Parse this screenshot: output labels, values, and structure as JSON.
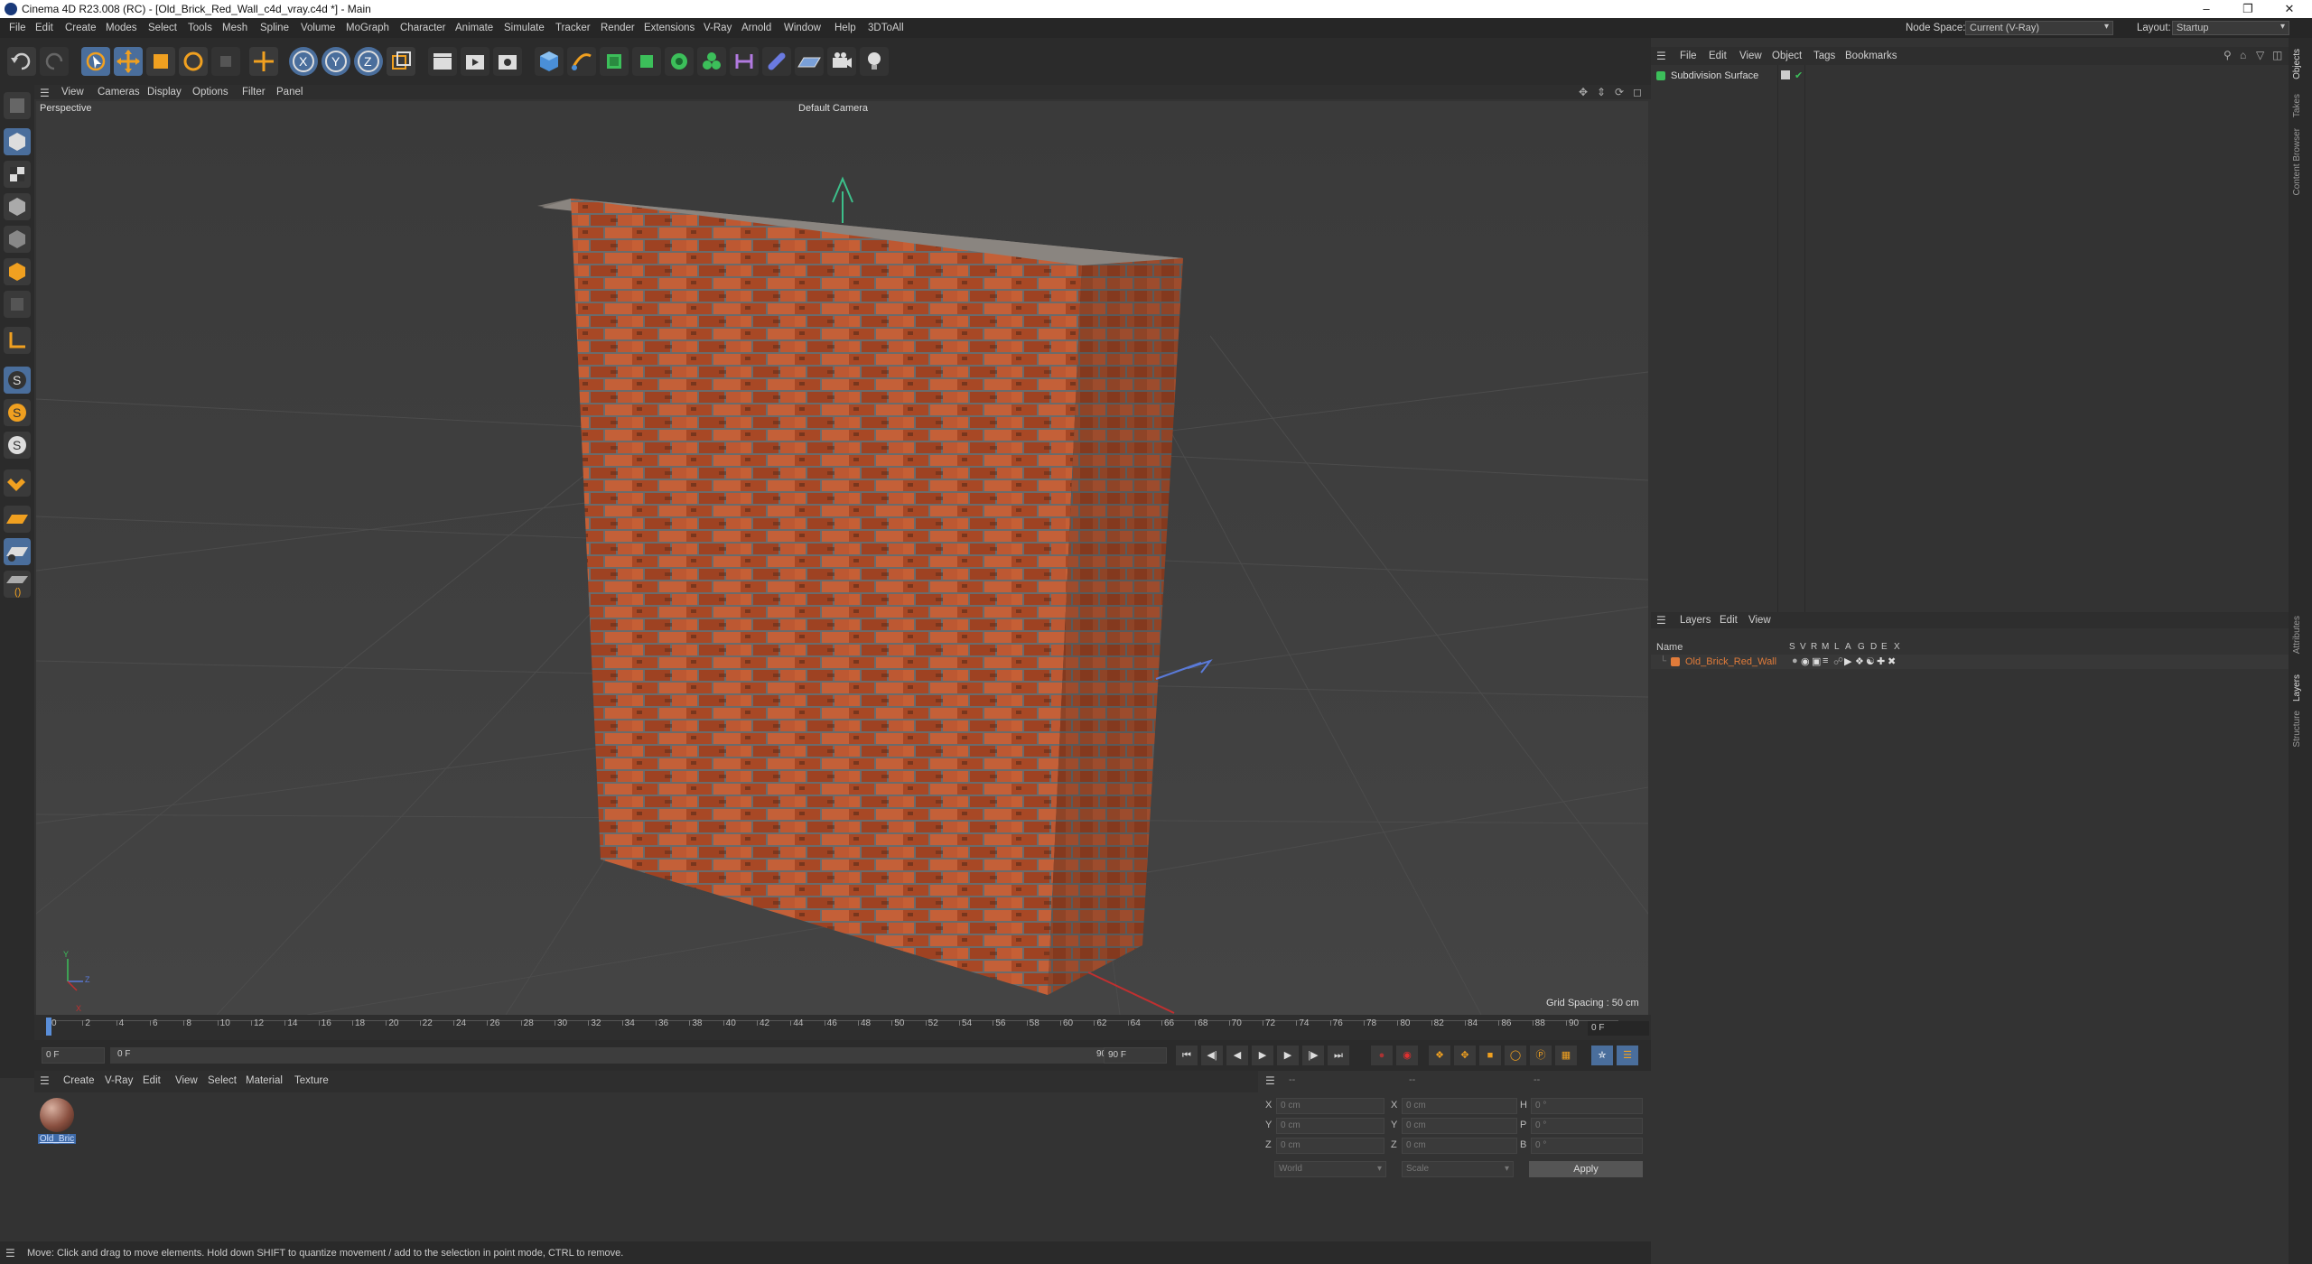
{
  "window": {
    "title": "Cinema 4D R23.008 (RC) - [Old_Brick_Red_Wall_c4d_vray.c4d *] - Main",
    "minimize": "–",
    "restore": "❐",
    "close": "✕"
  },
  "menubar": {
    "items": [
      "File",
      "Edit",
      "Create",
      "Modes",
      "Select",
      "Tools",
      "Mesh",
      "Spline",
      "Volume",
      "MoGraph",
      "Character",
      "Animate",
      "Simulate",
      "Tracker",
      "Render",
      "Extensions",
      "V-Ray",
      "Arnold",
      "Window",
      "Help",
      "3DToAll"
    ],
    "node_space_label": "Node Space:",
    "node_space_value": "Current (V-Ray)",
    "layout_label": "Layout:",
    "layout_value": "Startup"
  },
  "viewport": {
    "menu": [
      "View",
      "Cameras",
      "Display",
      "Options",
      "Filter",
      "Panel"
    ],
    "label": "Perspective",
    "camera": "Default Camera",
    "grid_spacing": "Grid Spacing : 50 cm",
    "axis_x": "X",
    "axis_y": "Y",
    "axis_z": "Z"
  },
  "timeline": {
    "ticks": [
      "0",
      "2",
      "4",
      "6",
      "8",
      "10",
      "12",
      "14",
      "16",
      "18",
      "20",
      "22",
      "24",
      "26",
      "28",
      "30",
      "32",
      "34",
      "36",
      "38",
      "40",
      "42",
      "44",
      "46",
      "48",
      "50",
      "52",
      "54",
      "56",
      "58",
      "60",
      "62",
      "64",
      "66",
      "68",
      "70",
      "72",
      "74",
      "76",
      "78",
      "80",
      "82",
      "84",
      "86",
      "88",
      "90"
    ],
    "current_frame": "0 F",
    "start_frame": "0 F",
    "range_start": "0 F",
    "range_end": "90 F",
    "end_frame": "90 F"
  },
  "materials": {
    "menu": [
      "Create",
      "V-Ray",
      "Edit",
      "View",
      "Select",
      "Material",
      "Texture"
    ],
    "items": [
      {
        "name": "Old_Bric"
      }
    ]
  },
  "coords": {
    "header_dashes": [
      "--",
      "--",
      "--"
    ],
    "rows": [
      {
        "a": "X",
        "av": "0 cm",
        "b": "X",
        "bv": "0 cm",
        "c": "H",
        "cv": "0 °"
      },
      {
        "a": "Y",
        "av": "0 cm",
        "b": "Y",
        "bv": "0 cm",
        "c": "P",
        "cv": "0 °"
      },
      {
        "a": "Z",
        "av": "0 cm",
        "b": "Z",
        "bv": "0 cm",
        "c": "B",
        "cv": "0 °"
      }
    ],
    "mode": "World",
    "scale": "Scale",
    "apply": "Apply"
  },
  "status": {
    "text": "Move: Click and drag to move elements. Hold down SHIFT to quantize movement / add to the selection in point mode, CTRL to remove."
  },
  "objects": {
    "menu": [
      "File",
      "Edit",
      "View",
      "Object",
      "Tags",
      "Bookmarks"
    ],
    "items": [
      {
        "name": "Subdivision Surface"
      }
    ]
  },
  "layers": {
    "menu": [
      "Layers",
      "Edit",
      "View"
    ],
    "header_name": "Name",
    "columns": [
      "S",
      "V",
      "R",
      "M",
      "L",
      "A",
      "G",
      "D",
      "E",
      "X"
    ],
    "items": [
      {
        "name": "Old_Brick_Red_Wall",
        "color": "#e07b3a"
      }
    ]
  },
  "side_tabs": [
    "Objects",
    "Takes",
    "Content Browser",
    "Attributes",
    "Layers",
    "Structure"
  ],
  "colors": {
    "accent": "#5a8ed8",
    "layer_orange": "#e07b3a",
    "brick": "#b5502c"
  }
}
